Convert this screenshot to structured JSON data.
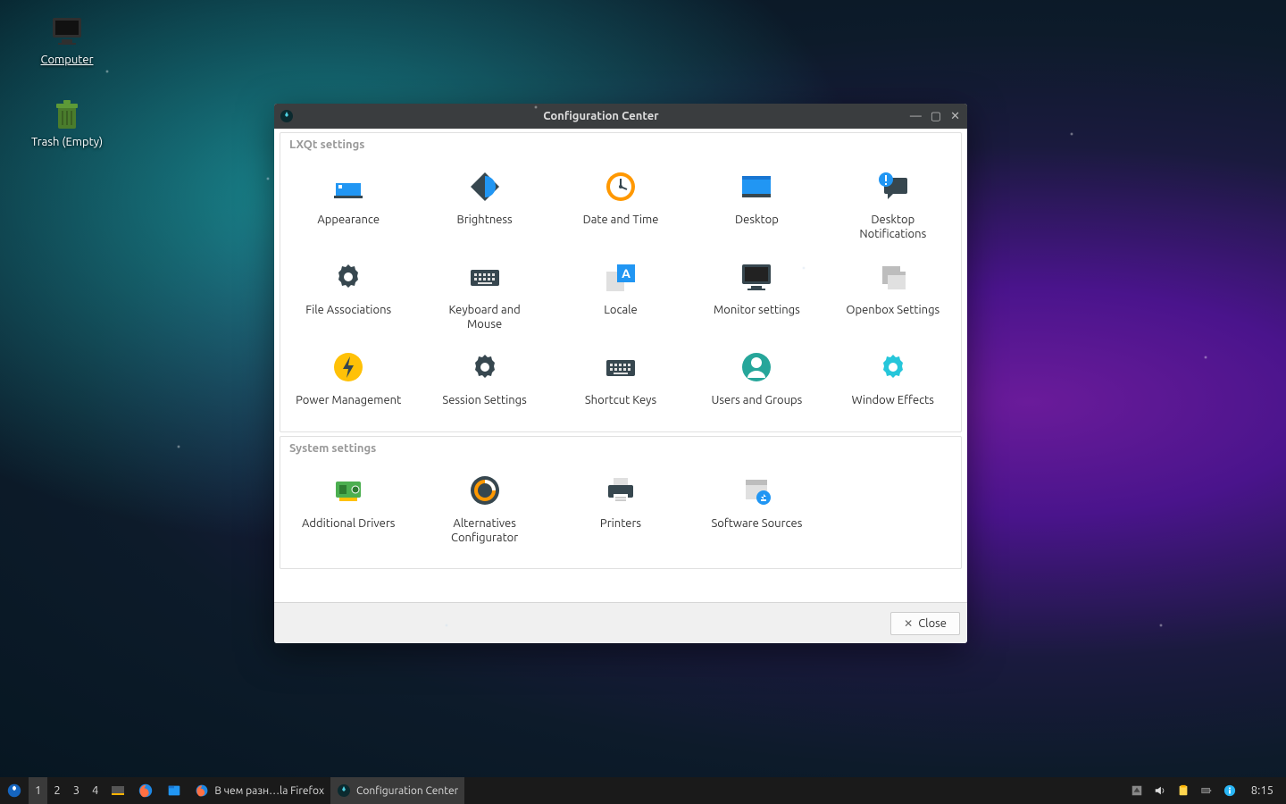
{
  "desktop": {
    "computer": "Computer",
    "trash": "Trash (Empty)"
  },
  "window": {
    "title": "Configuration Center",
    "close_label": "Close",
    "sections": {
      "lxqt": {
        "title": "LXQt settings",
        "items": {
          "appearance": "Appearance",
          "brightness": "Brightness",
          "datetime": "Date and Time",
          "desktop": "Desktop",
          "notifications": "Desktop\nNotifications",
          "fileassoc": "File Associations",
          "kbmouse": "Keyboard and\nMouse",
          "locale": "Locale",
          "monitor": "Monitor settings",
          "openbox": "Openbox Settings",
          "power": "Power Management",
          "session": "Session Settings",
          "shortcuts": "Shortcut Keys",
          "users": "Users and Groups",
          "effects": "Window Effects"
        }
      },
      "system": {
        "title": "System settings",
        "items": {
          "drivers": "Additional Drivers",
          "alternatives": "Alternatives\nConfigurator",
          "printers": "Printers",
          "software": "Software Sources"
        }
      }
    }
  },
  "taskbar": {
    "workspaces": [
      "1",
      "2",
      "3",
      "4"
    ],
    "tasks": {
      "firefox": "В чем разн…la Firefox",
      "config": "Configuration Center"
    },
    "clock": "8:15"
  }
}
